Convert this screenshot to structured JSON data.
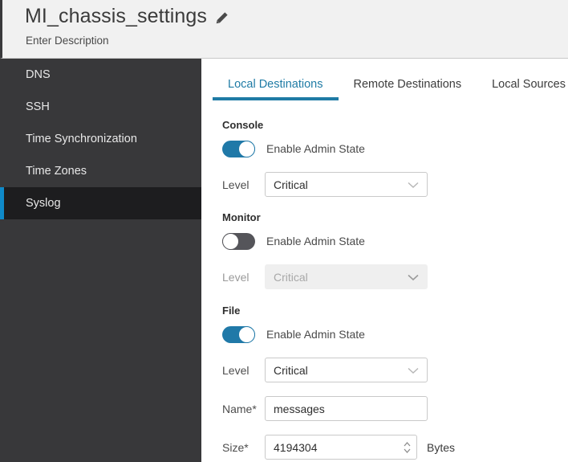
{
  "header": {
    "title": "MI_chassis_settings",
    "edit_icon": "pencil-icon",
    "description_placeholder": "Enter Description"
  },
  "sidebar": {
    "items": [
      {
        "label": "DNS",
        "selected": false
      },
      {
        "label": "SSH",
        "selected": false
      },
      {
        "label": "Time Synchronization",
        "selected": false
      },
      {
        "label": "Time Zones",
        "selected": false
      },
      {
        "label": "Syslog",
        "selected": true
      }
    ]
  },
  "tabs": [
    {
      "label": "Local Destinations",
      "active": true
    },
    {
      "label": "Remote Destinations",
      "active": false
    },
    {
      "label": "Local Sources",
      "active": false
    }
  ],
  "sections": {
    "console": {
      "title": "Console",
      "toggle_state": "on",
      "toggle_label": "Enable Admin State",
      "level_label": "Level",
      "level_value": "Critical",
      "enabled": true
    },
    "monitor": {
      "title": "Monitor",
      "toggle_state": "off",
      "toggle_label": "Enable Admin State",
      "level_label": "Level",
      "level_value": "Critical",
      "enabled": false
    },
    "file": {
      "title": "File",
      "toggle_state": "on",
      "toggle_label": "Enable Admin State",
      "level_label": "Level",
      "level_value": "Critical",
      "name_label": "Name*",
      "name_value": "messages",
      "size_label": "Size*",
      "size_value": "4194304",
      "size_unit": "Bytes",
      "enabled": true
    }
  },
  "colors": {
    "accent_blue": "#1f7ba5",
    "toggle_on": "#2079a8",
    "sidebar_accent": "#0f8ac9",
    "sidebar_bg": "#38383a",
    "sidebar_selected_bg": "#1d1d1f",
    "header_bg": "#f1f1f1"
  }
}
